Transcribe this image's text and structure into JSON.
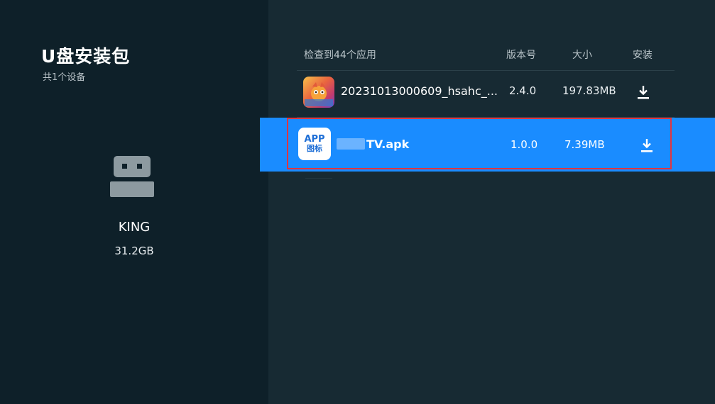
{
  "left": {
    "title": "U盘安装包",
    "subtitle": "共1个设备",
    "device": {
      "name": "KING",
      "size": "31.2GB",
      "icon": "usb-drive-icon"
    }
  },
  "list": {
    "header": {
      "count": "检查到44个应用",
      "version": "版本号",
      "size": "大小",
      "install": "安装"
    },
    "rows": [
      {
        "name": "20231013000609_hsahc_...",
        "version": "2.4.0",
        "size": "197.83MB",
        "icon": "game-app-icon",
        "action_icon": "download-icon"
      },
      {
        "name": "TV.apk",
        "version": "1.0.0",
        "size": "7.39MB",
        "icon_line1": "APP",
        "icon_line2": "图标",
        "action_icon": "download-icon",
        "selected": true
      }
    ]
  },
  "colors": {
    "accent": "#1a8cff",
    "focus_border": "#e2353f",
    "left_bg": "#0e2029",
    "right_bg": "#172a33"
  }
}
